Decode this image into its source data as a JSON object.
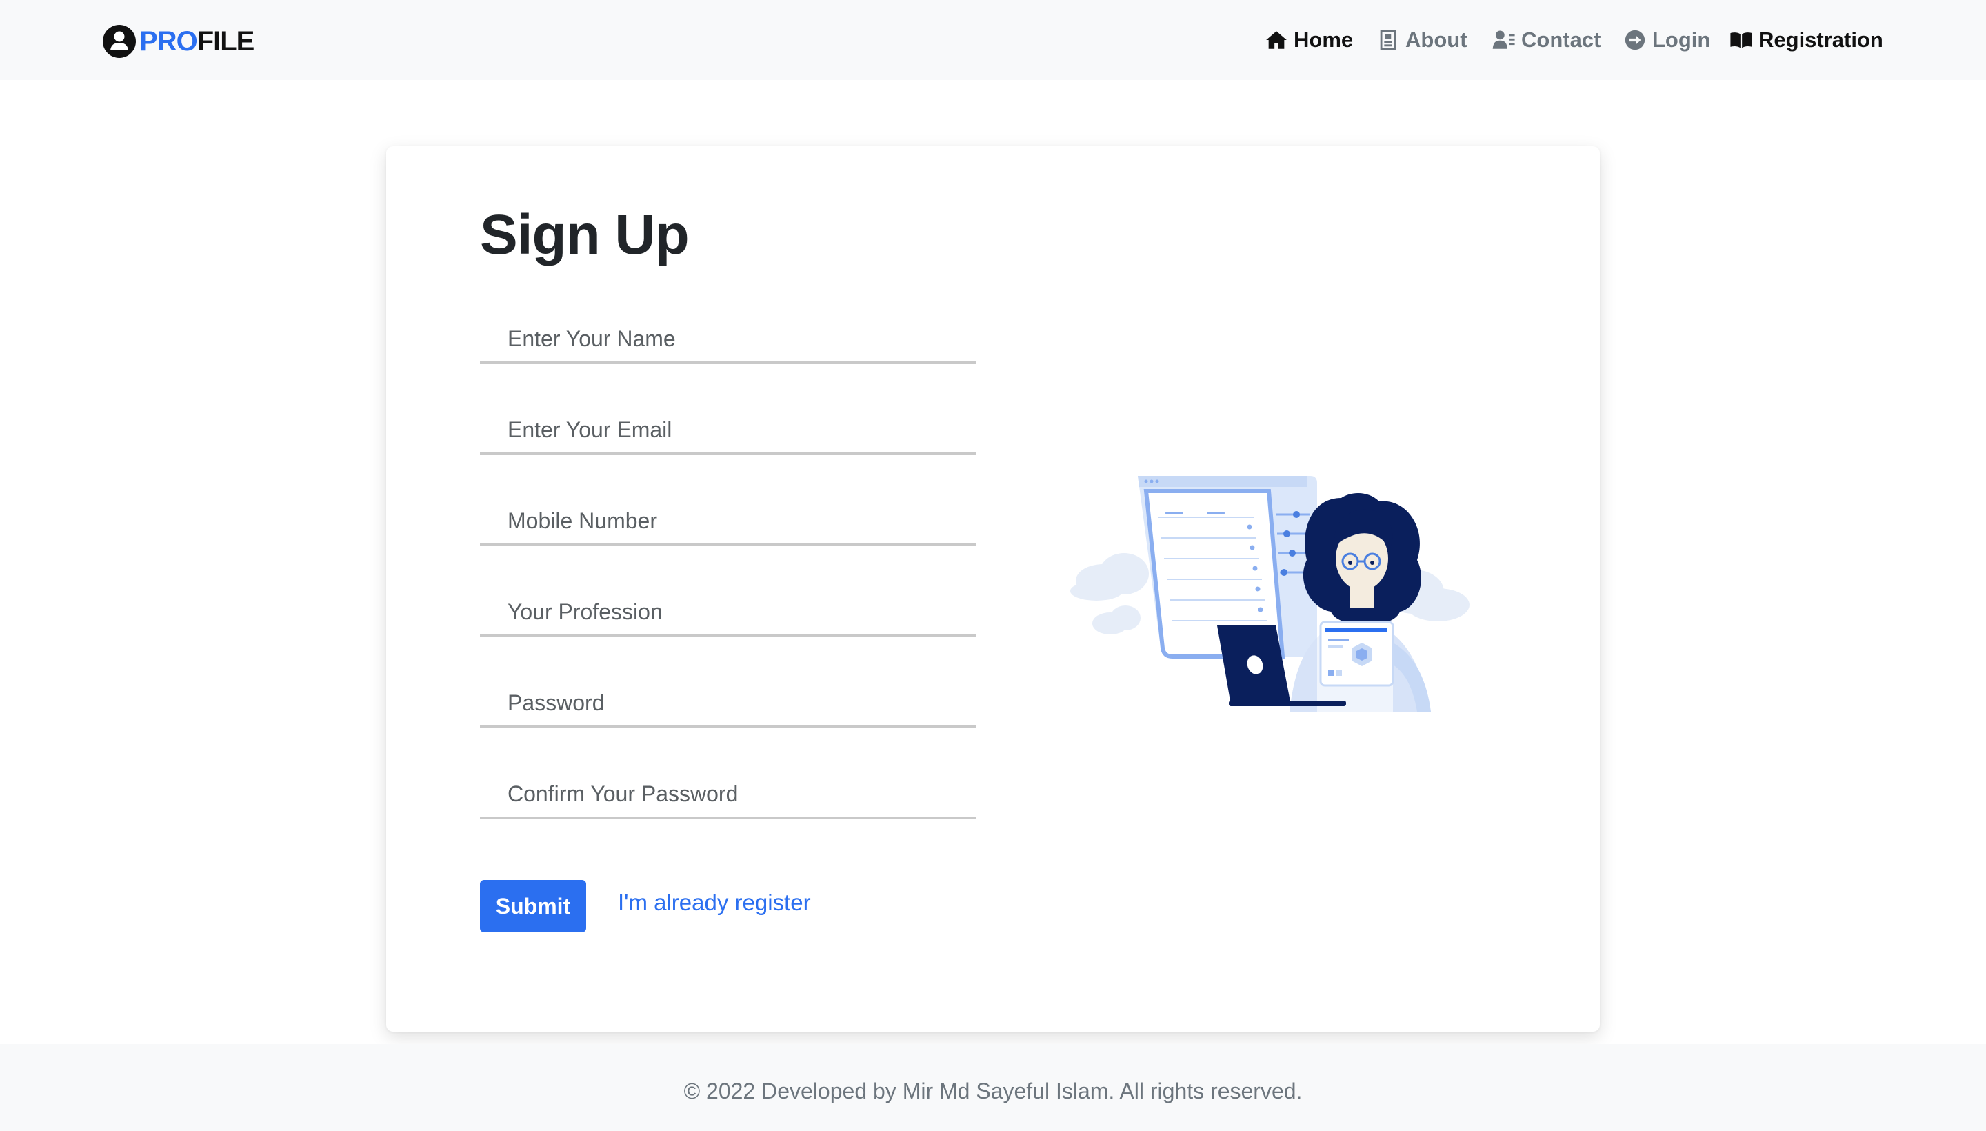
{
  "brand": {
    "part1": "PRO",
    "part2": "FILE",
    "icon": "user-circle-icon"
  },
  "nav": {
    "home": "Home",
    "about": "About",
    "contact": "Contact",
    "login": "Login",
    "registration": "Registration"
  },
  "form": {
    "title": "Sign Up",
    "name_placeholder": "Enter Your Name",
    "email_placeholder": "Enter Your Email",
    "mobile_placeholder": "Mobile Number",
    "profession_placeholder": "Your Profession",
    "password_placeholder": "Password",
    "confirm_placeholder": "Confirm Your Password",
    "submit_label": "Submit",
    "already_link": "I'm already register"
  },
  "footer": {
    "text": "© 2022 Developed by Mir Md Sayeful Islam. All rights reserved."
  },
  "colors": {
    "accent": "#2b6ff0",
    "navbar_bg": "#f8f9fa",
    "illustration_navy": "#0a1f5c"
  }
}
